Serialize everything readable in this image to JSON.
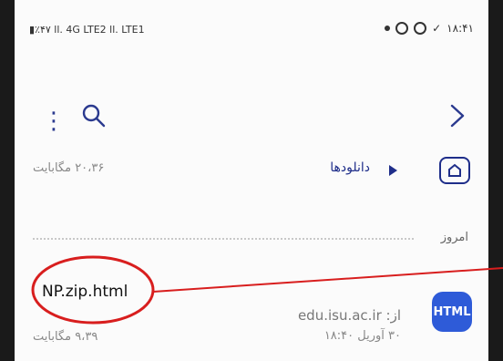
{
  "status_bar": {
    "left_text": "▮٪۴۷ ll. 4G LTE2 ll. LTE1",
    "time": "۱۸:۴۱"
  },
  "toolbar": {
    "menu_icon": "more-vert-icon",
    "search_icon": "search-icon",
    "forward_icon": "chevron-right-icon"
  },
  "breadcrumb": {
    "home_icon": "home-folder-icon",
    "label": "دانلودها",
    "total_size": "۲۰،۳۶ مگابایت"
  },
  "section": {
    "label": "امروز"
  },
  "file": {
    "name": "NP.zip.html",
    "source": "از: edu.isu.ac.ir",
    "date": "۳۰ آوریل ۱۸:۴۰",
    "size": "۹،۳۹ مگابایت",
    "badge": "HTML",
    "badge_color": "#2e5bd8"
  },
  "annotation": {
    "circle_color": "#d81e1e"
  }
}
